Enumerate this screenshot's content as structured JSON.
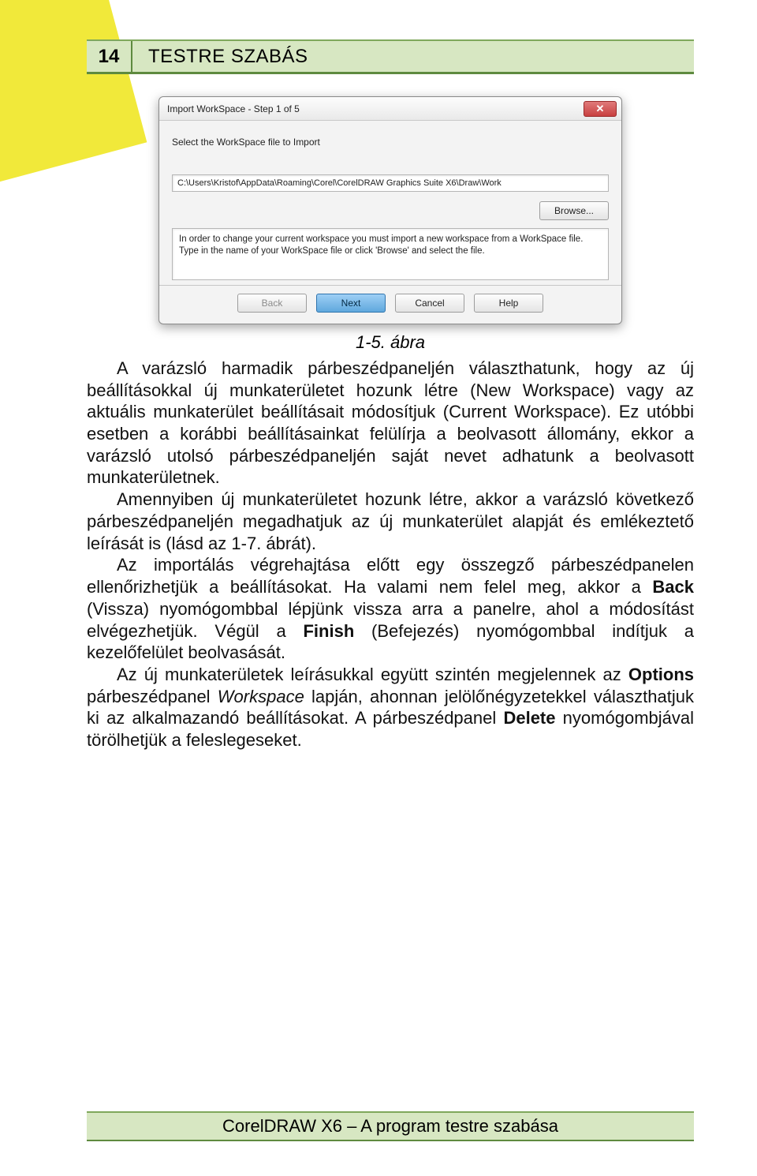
{
  "header": {
    "page_number": "14",
    "title": "TESTRE SZABÁS"
  },
  "dialog": {
    "title": "Import WorkSpace - Step 1 of 5",
    "instruction": "Select the WorkSpace file to Import",
    "path": "C:\\Users\\Kristof\\AppData\\Roaming\\Corel\\CorelDRAW Graphics Suite X6\\Draw\\Work",
    "browse": "Browse...",
    "info": "In order to change your current workspace you must import a new workspace from a WorkSpace file. Type in the name of your WorkSpace file or click 'Browse' and select the file.",
    "back": "Back",
    "next": "Next",
    "cancel": "Cancel",
    "help": "Help"
  },
  "caption": "1-5. ábra",
  "paragraphs": {
    "p1a": "A varázsló harmadik párbeszédpaneljén választhatunk, hogy az új beállításokkal új munkaterületet hozunk létre (New Workspace) vagy az aktuális munkaterület beállításait módosítjuk (Current Workspace). Ez utóbbi esetben a korábbi beállításainkat felülírja a beolvasott állomány, ekkor a varázsló utolsó párbeszédpaneljén saját nevet adhatunk a beolvasott munkaterületnek.",
    "p2": "Amennyiben új munkaterületet hozunk létre, akkor a varázsló következő párbeszédpaneljén megadhatjuk az új munkaterület alapját és emlékeztető leírását is (lásd az 1-7. ábrát).",
    "p3a": "Az importálás végrehajtása előtt egy összegző párbeszédpanelen ellenőrizhetjük a beállításokat. Ha valami nem felel meg, akkor a ",
    "p3b": " (Vissza) nyomógombbal lépjünk vissza arra a panelre, ahol a módosítást elvégezhetjük. Végül a ",
    "p3c": " (Befejezés) nyomógombbal indítjuk a kezelőfelület beolvasását.",
    "p4a": "Az új munkaterületek leírásukkal együtt szintén megjelennek az ",
    "p4b": " párbeszédpanel ",
    "p4c": " lapján, ahonnan jelölőnégyzetekkel választhatjuk ki az alkalmazandó beállításokat. A párbeszédpanel ",
    "p4d": " nyomógombjával törölhetjük a feleslegeseket.",
    "back_bold": "Back",
    "finish_bold": "Finish",
    "options_bold": "Options",
    "workspace_italic": "Workspace",
    "delete_bold": "Delete"
  },
  "footer": "CorelDRAW X6 – A program testre szabása"
}
